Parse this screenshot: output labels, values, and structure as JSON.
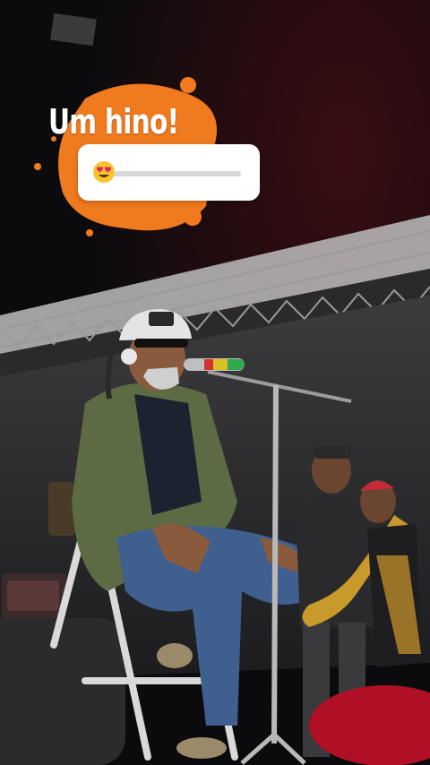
{
  "story": {
    "caption": "Um hino!",
    "slider_sticker": {
      "emoji": "smiling-face-with-heart-eyes",
      "value": 0.0,
      "track_color": "#d8d8d8"
    }
  },
  "colors": {
    "splash": "#f07a1e",
    "background": "#0b0b0d"
  }
}
